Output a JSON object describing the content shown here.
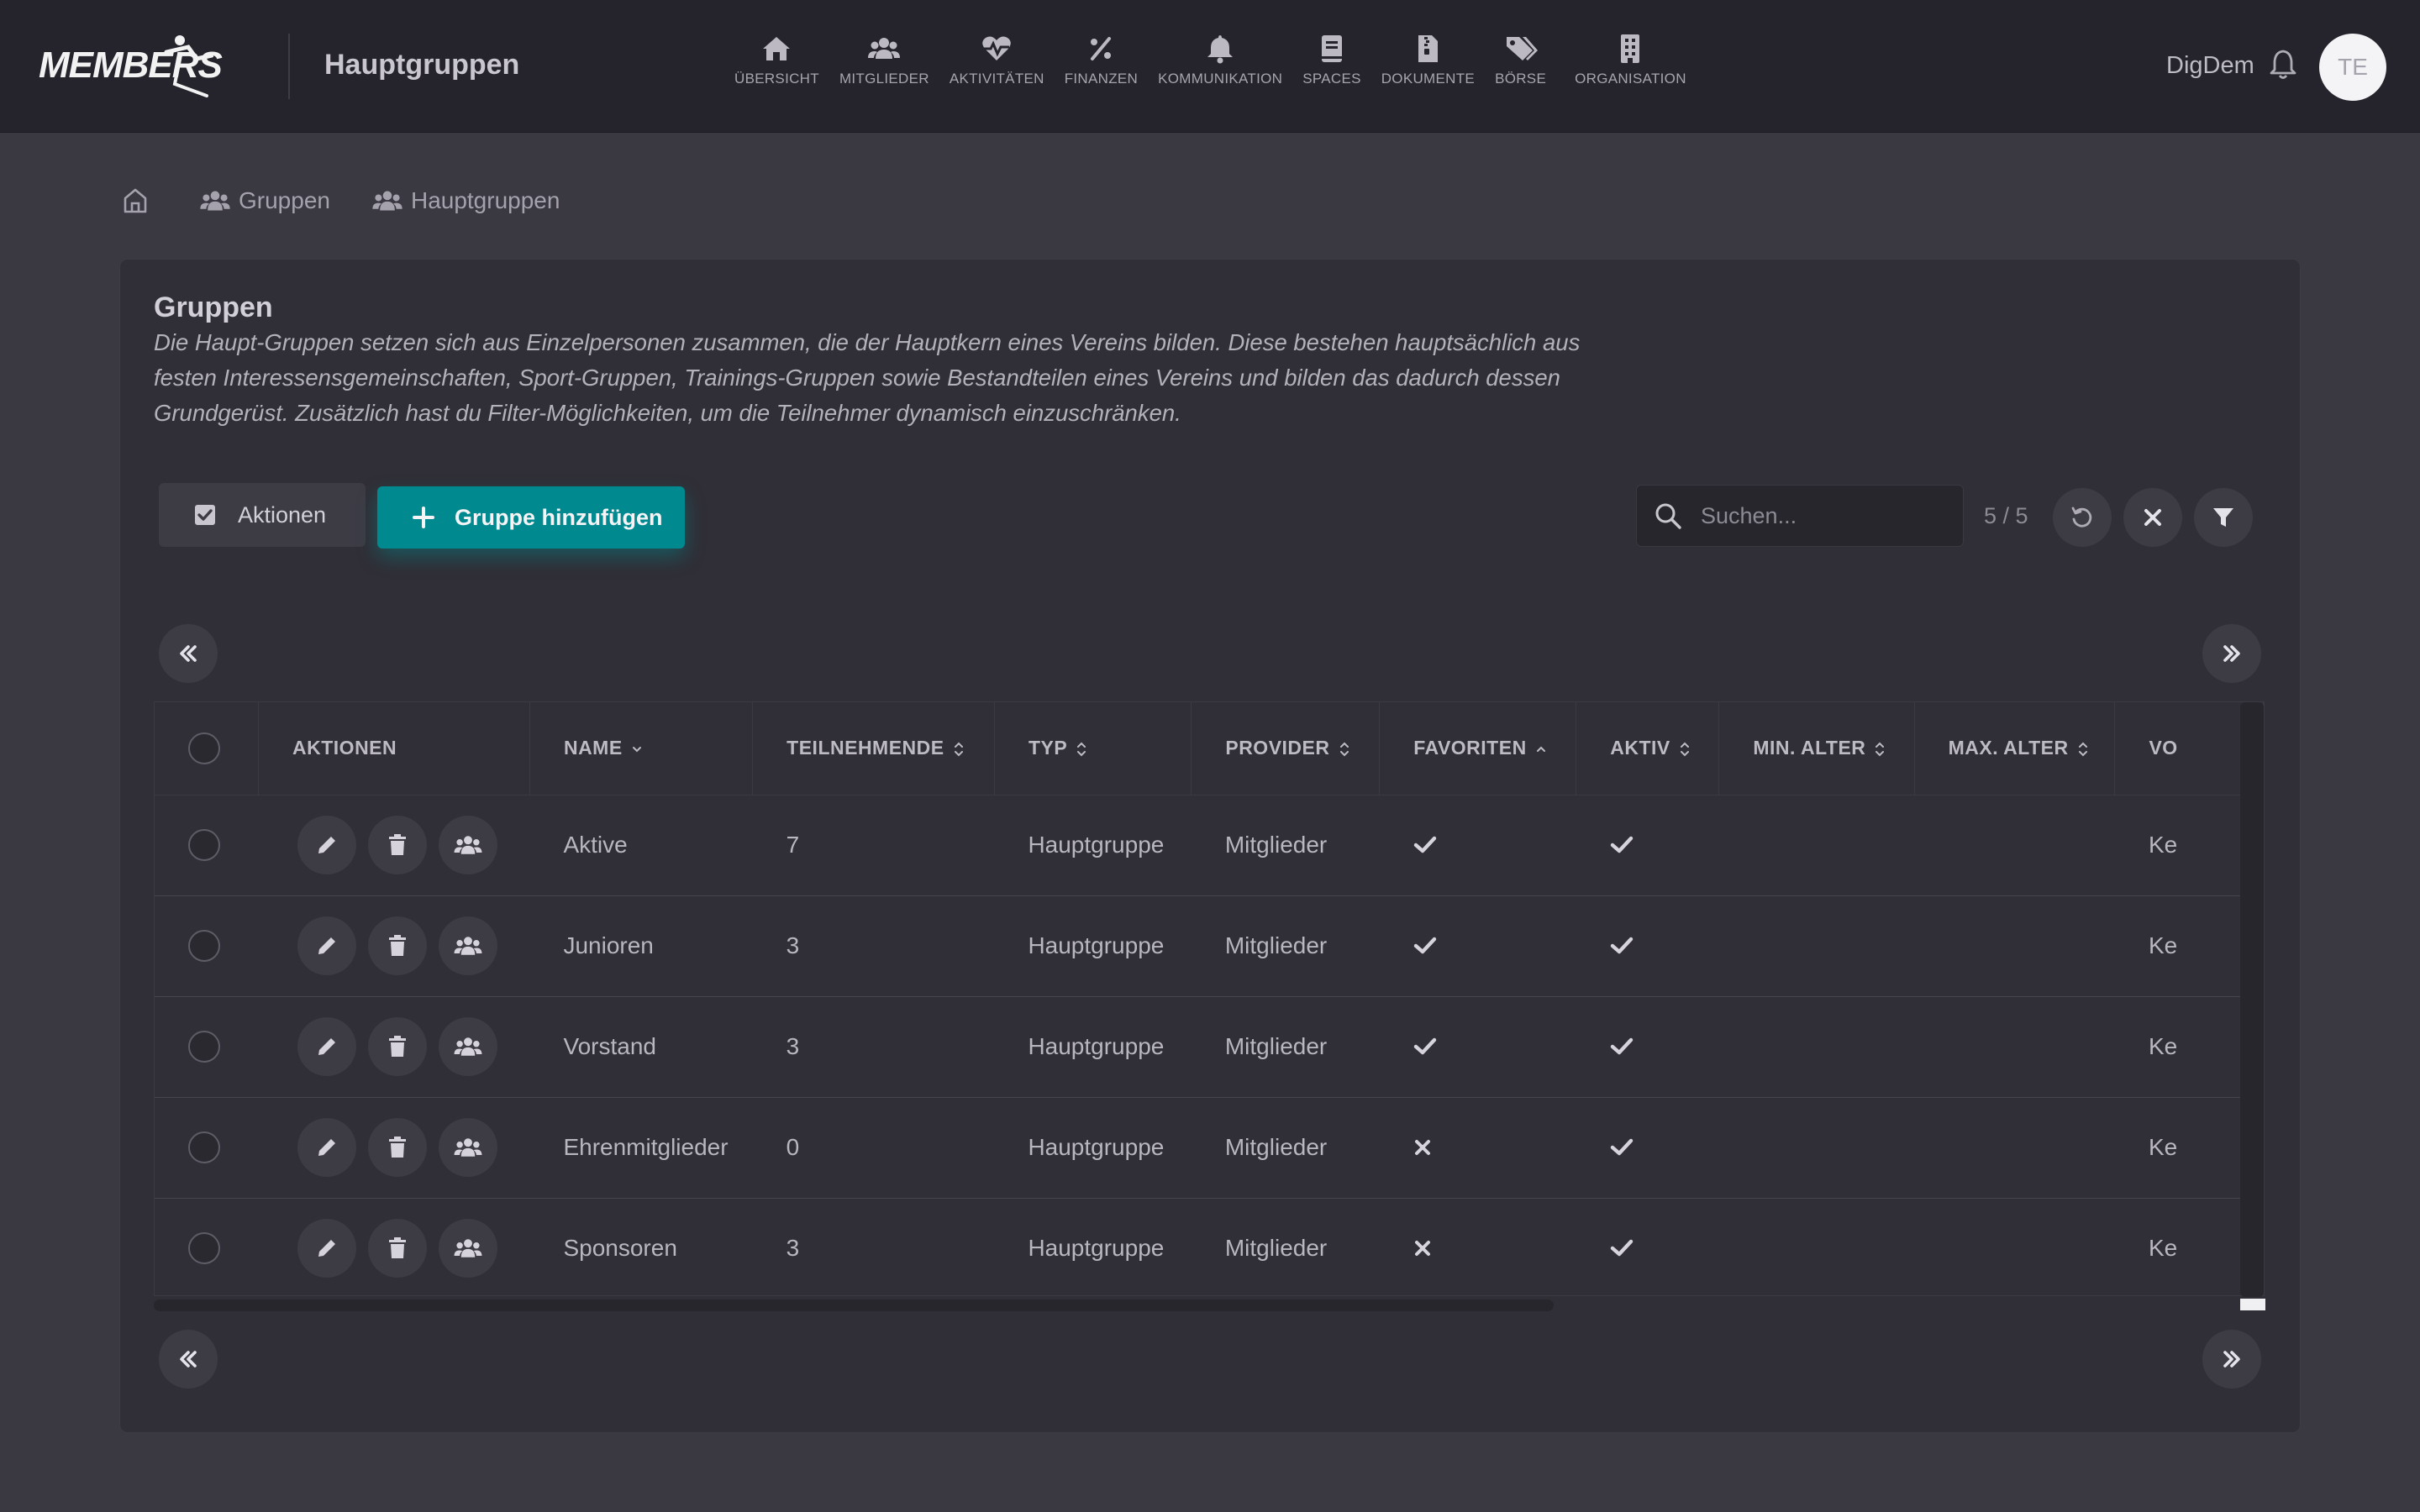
{
  "app": {
    "logo_text": "MEMBERS",
    "title": "Hauptgruppen"
  },
  "nav": [
    {
      "label": "ÜBERSICHT",
      "icon": "home-icon"
    },
    {
      "label": "MITGLIEDER",
      "icon": "users-icon"
    },
    {
      "label": "AKTIVITÄTEN",
      "icon": "heart-pulse-icon"
    },
    {
      "label": "FINANZEN",
      "icon": "percent-icon"
    },
    {
      "label": "KOMMUNIKATION",
      "icon": "bell-icon"
    },
    {
      "label": "SPACES",
      "icon": "book-icon"
    },
    {
      "label": "DOKUMENTE",
      "icon": "file-zip-icon"
    },
    {
      "label": "BÖRSE",
      "icon": "tags-icon"
    },
    {
      "label": "ORGANISATION",
      "icon": "building-icon"
    }
  ],
  "user": {
    "name": "DigDem",
    "initials": "TE"
  },
  "breadcrumb": [
    {
      "label": "",
      "icon": "home-icon"
    },
    {
      "label": "Gruppen",
      "icon": "users-icon"
    },
    {
      "label": "Hauptgruppen",
      "icon": "users-icon"
    }
  ],
  "card": {
    "title": "Gruppen",
    "description": "Die Haupt-Gruppen setzen sich aus Einzelpersonen zusammen, die der Hauptkern eines Vereins bilden. Diese bestehen hauptsächlich aus festen Interessensgemeinschaften, Sport-Gruppen, Trainings-Gruppen sowie Bestandteilen eines Vereins und bilden das dadurch dessen Grundgerüst. Zusätzlich hast du Filter-Möglichkeiten, um die Teilnehmer dynamisch einzuschränken."
  },
  "toolbar": {
    "actions_label": "Aktionen",
    "add_label": "Gruppe hinzufügen",
    "search_placeholder": "Suchen...",
    "count": "5 / 5"
  },
  "colors": {
    "accent": "#00898f",
    "background": "#3a3841",
    "topbar": "#25232b",
    "card": "#302e36"
  },
  "table": {
    "columns": [
      "AKTIONEN",
      "NAME",
      "TEILNEHMENDE",
      "TYP",
      "PROVIDER",
      "FAVORITEN",
      "AKTIV",
      "MIN. ALTER",
      "MAX. ALTER",
      "VO"
    ],
    "rows": [
      {
        "name": "Aktive",
        "participants": "7",
        "type": "Hauptgruppe",
        "provider": "Mitglieder",
        "favorite": true,
        "active": true,
        "min_age": "",
        "max_age": "",
        "vo": "Ke"
      },
      {
        "name": "Junioren",
        "participants": "3",
        "type": "Hauptgruppe",
        "provider": "Mitglieder",
        "favorite": true,
        "active": true,
        "min_age": "",
        "max_age": "",
        "vo": "Ke"
      },
      {
        "name": "Vorstand",
        "participants": "3",
        "type": "Hauptgruppe",
        "provider": "Mitglieder",
        "favorite": true,
        "active": true,
        "min_age": "",
        "max_age": "",
        "vo": "Ke"
      },
      {
        "name": "Ehrenmitglieder",
        "participants": "0",
        "type": "Hauptgruppe",
        "provider": "Mitglieder",
        "favorite": false,
        "active": true,
        "min_age": "",
        "max_age": "",
        "vo": "Ke"
      },
      {
        "name": "Sponsoren",
        "participants": "3",
        "type": "Hauptgruppe",
        "provider": "Mitglieder",
        "favorite": false,
        "active": true,
        "min_age": "",
        "max_age": "",
        "vo": "Ke"
      }
    ]
  }
}
